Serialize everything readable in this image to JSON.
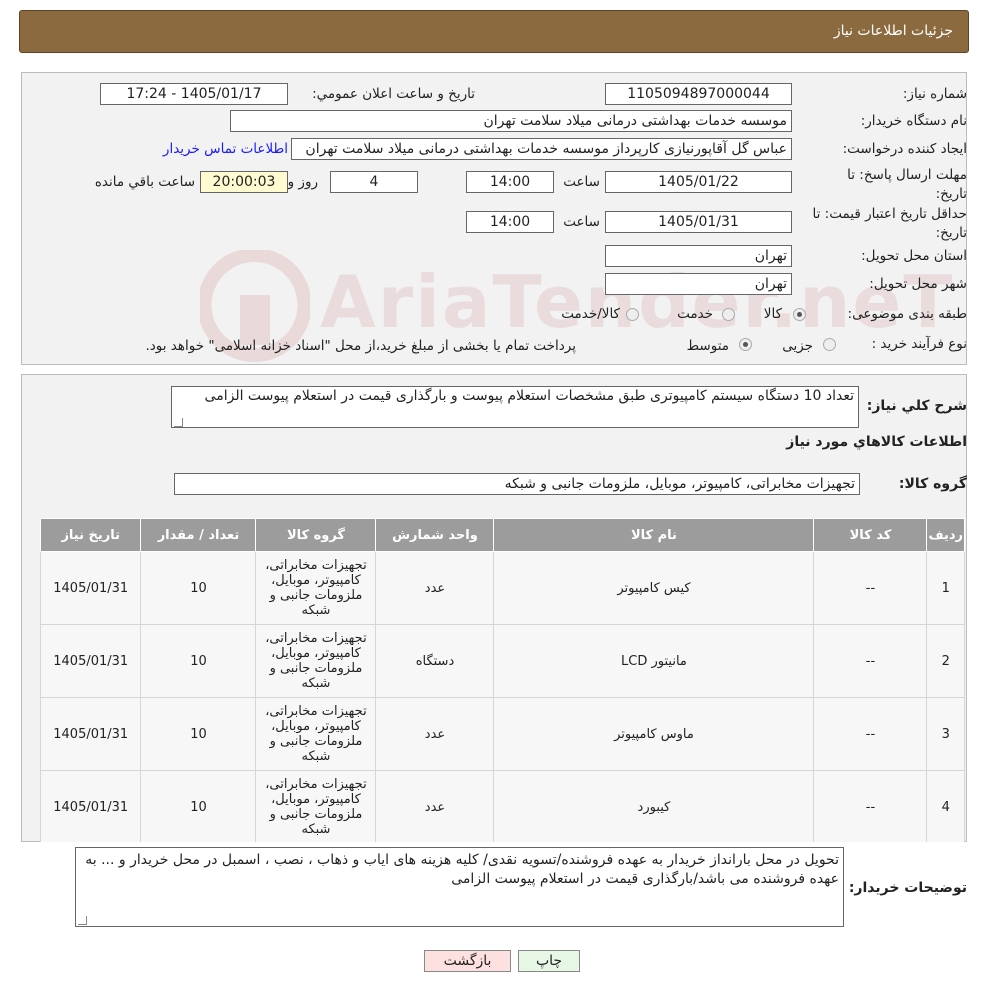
{
  "header": {
    "title": "جزئیات اطلاعات نیاز"
  },
  "info": {
    "need_number_label": "شماره نیاز:",
    "need_number": "1105094897000044",
    "announce_label": "تاریخ و ساعت اعلان عمومي:",
    "announce_value": "1405/01/17 - 17:24",
    "buyer_org_label": "نام دستگاه خریدار:",
    "buyer_org": "موسسه خدمات بهداشتی درمانی میلاد سلامت تهران",
    "creator_label": "ایجاد کننده درخواست:",
    "creator": "عباس گل آقاپورنیازی کارپرداز موسسه خدمات بهداشتی درمانی میلاد سلامت تهران",
    "contact_link": "اطلاعات تماس خریدار",
    "deadline_label": "مهلت ارسال پاسخ: تا تاریخ:",
    "deadline_date": "1405/01/22",
    "time_label": "ساعت",
    "deadline_time": "14:00",
    "days": "4",
    "days_label": "روز و",
    "remaining": "20:00:03",
    "remaining_label": "ساعت باقي مانده",
    "validity_label": "حداقل تاریخ اعتبار قیمت: تا تاریخ:",
    "validity_date": "1405/01/31",
    "validity_time": "14:00",
    "province_label": "استان محل تحویل:",
    "province": "تهران",
    "city_label": "شهر محل تحویل:",
    "city": "تهران",
    "category_label": "طبقه بندی موضوعی:",
    "category_options": [
      "کالا",
      "خدمت",
      "کالا/خدمت"
    ],
    "process_label": "نوع فرآیند خرید :",
    "process_options": [
      "جزیی",
      "متوسط"
    ],
    "process_note": "پرداخت تمام یا بخشی از مبلغ خرید،از محل \"اسناد خزانه اسلامی\" خواهد بود."
  },
  "summary": {
    "desc_label": "شرح كلي نیاز:",
    "desc": "تعداد 10 دستگاه سیستم کامپیوتری طبق مشخصات استعلام پیوست و بارگذاری قیمت در استعلام پیوست الزامی",
    "goods_info_title": "اطلاعات كالاهاي مورد نیاز",
    "group_label": "گروه كالا:",
    "group": "تجهیزات مخابراتی، کامپیوتر، موبایل، ملزومات جانبی و شبکه"
  },
  "table": {
    "headers": [
      "ردیف",
      "كد كالا",
      "نام كالا",
      "واحد شمارش",
      "گروه كالا",
      "تعداد / مقدار",
      "تاریخ نیاز"
    ],
    "rows": [
      [
        "1",
        "--",
        "کیس کامپیوتر",
        "عدد",
        "تجهیزات مخابراتی، کامپیوتر، موبایل، ملزومات جانبی و شبکه",
        "10",
        "1405/01/31"
      ],
      [
        "2",
        "--",
        "مانیتور LCD",
        "دستگاه",
        "تجهیزات مخابراتی، کامپیوتر، موبایل، ملزومات جانبی و شبکه",
        "10",
        "1405/01/31"
      ],
      [
        "3",
        "--",
        "ماوس کامپیوتر",
        "عدد",
        "تجهیزات مخابراتی، کامپیوتر، موبایل، ملزومات جانبی و شبکه",
        "10",
        "1405/01/31"
      ],
      [
        "4",
        "--",
        "کیبورد",
        "عدد",
        "تجهیزات مخابراتی، کامپیوتر، موبایل، ملزومات جانبی و شبکه",
        "10",
        "1405/01/31"
      ]
    ]
  },
  "buyer_notes": {
    "label": "توضیحات خریدار:",
    "text": "تحویل در محل بارانداز خریدار به عهده فروشنده/تسویه نقدی/ کلیه هزینه های ایاب و ذهاب ، نصب ، اسمبل در محل خریدار و ... به عهده فروشنده می باشد/بارگذاری قیمت در استعلام پیوست الزامی"
  },
  "buttons": {
    "print": "چاپ",
    "back": "بازگشت"
  },
  "watermark": "AriaTender.neT",
  "colors": {
    "header_bg": "#8b6a3f",
    "table_header": "#9c9c9c",
    "link": "#1a1aff",
    "back_bg": "#fde0e0",
    "print_bg": "#e6f7e6"
  }
}
